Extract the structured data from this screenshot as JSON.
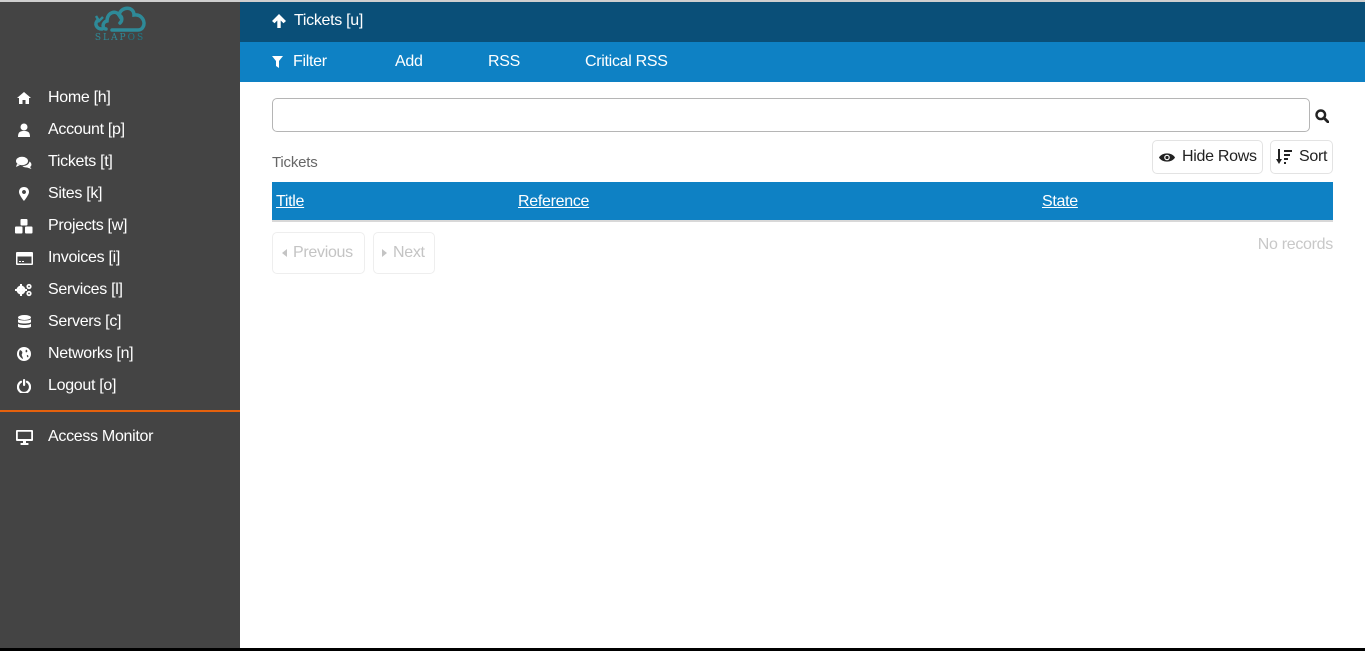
{
  "brand": {
    "name_part1": "SLAP",
    "name_part2": "OS",
    "logo_color": "#2e8a98"
  },
  "sidebar": {
    "items": [
      {
        "label": "Home [h]",
        "icon": "home-icon"
      },
      {
        "label": "Account [p]",
        "icon": "user-icon"
      },
      {
        "label": "Tickets [t]",
        "icon": "comments-icon"
      },
      {
        "label": "Sites [k]",
        "icon": "map-marker-icon"
      },
      {
        "label": "Projects [w]",
        "icon": "cubes-icon"
      },
      {
        "label": "Invoices [i]",
        "icon": "credit-card-icon"
      },
      {
        "label": "Services [l]",
        "icon": "gears-icon"
      },
      {
        "label": "Servers [c]",
        "icon": "database-icon"
      },
      {
        "label": "Networks [n]",
        "icon": "globe-icon"
      },
      {
        "label": "Logout [o]",
        "icon": "power-off-icon"
      }
    ],
    "extra_items": [
      {
        "label": "Access Monitor",
        "icon": "desktop-icon"
      }
    ],
    "divider_color": "#e5610d",
    "background": "#444444"
  },
  "header": {
    "breadcrumb": "Tickets [u]",
    "background": "#0a4f78"
  },
  "toolbar": {
    "background": "#0e81c4",
    "filter_label": "Filter",
    "add_label": "Add",
    "rss_label": "RSS",
    "critical_rss_label": "Critical RSS"
  },
  "search": {
    "value": "",
    "placeholder": ""
  },
  "list": {
    "title": "Tickets",
    "hide_rows_label": "Hide Rows",
    "sort_label": "Sort",
    "columns": [
      "Title",
      "Reference",
      "State"
    ],
    "rows": [],
    "empty_text": "No records"
  },
  "pagination": {
    "previous_label": "Previous",
    "next_label": "Next"
  }
}
